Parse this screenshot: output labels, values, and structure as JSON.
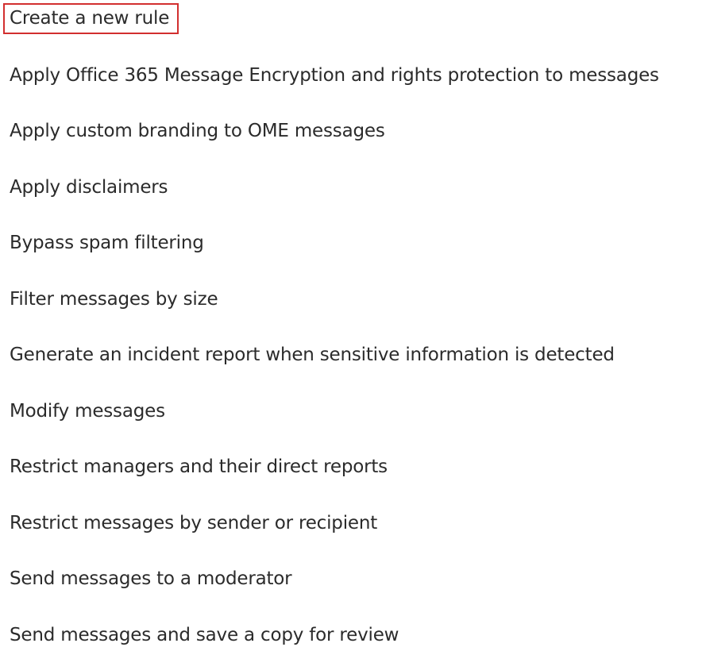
{
  "rules_menu": {
    "items": [
      {
        "label": "Create a new rule",
        "highlighted": true
      },
      {
        "label": "Apply Office 365 Message Encryption and rights protection to messages"
      },
      {
        "label": "Apply custom branding to OME messages"
      },
      {
        "label": "Apply disclaimers"
      },
      {
        "label": "Bypass spam filtering"
      },
      {
        "label": "Filter messages by size"
      },
      {
        "label": "Generate an incident report when sensitive information is detected"
      },
      {
        "label": "Modify messages"
      },
      {
        "label": "Restrict managers and their direct reports"
      },
      {
        "label": "Restrict messages by sender or recipient"
      },
      {
        "label": "Send messages to a moderator"
      },
      {
        "label": "Send messages and save a copy for review"
      }
    ]
  },
  "colors": {
    "text": "#2b2b2b",
    "highlight_border": "#d22f2f",
    "background": "#ffffff"
  }
}
